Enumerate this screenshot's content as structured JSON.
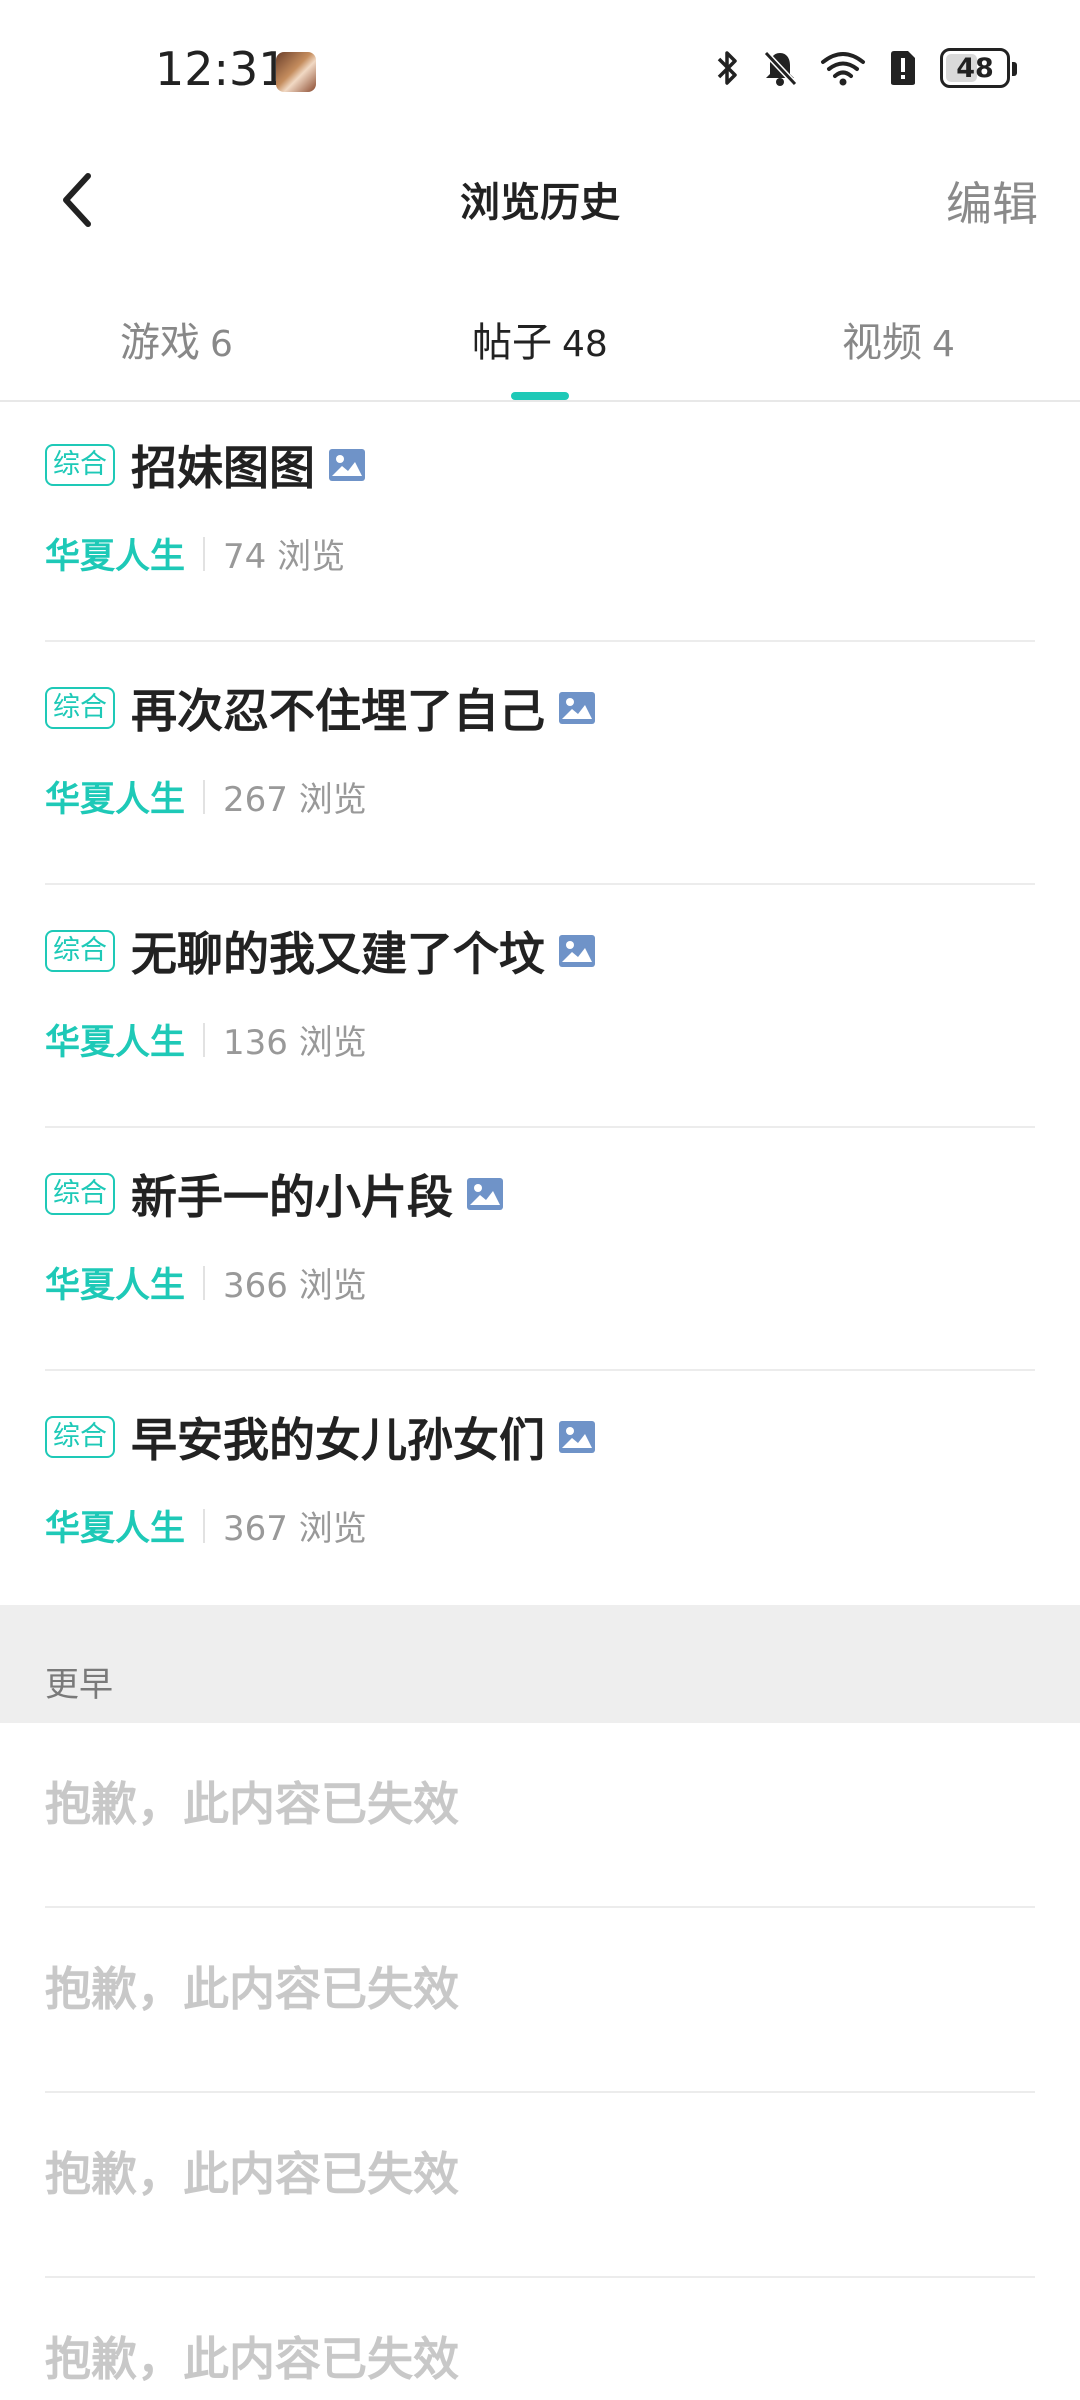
{
  "status_bar": {
    "time": "12:31",
    "battery_level": "48",
    "icons": [
      "bluetooth-icon",
      "bell-off-icon",
      "wifi-icon",
      "sim-alert-icon",
      "battery-icon"
    ]
  },
  "nav": {
    "title": "浏览历史",
    "edit_label": "编辑",
    "back_icon": "chevron-left-icon"
  },
  "tabs": [
    {
      "label": "游戏",
      "count": "6",
      "active": false
    },
    {
      "label": "帖子",
      "count": "48",
      "active": true
    },
    {
      "label": "视频",
      "count": "4",
      "active": false
    }
  ],
  "colors": {
    "accent": "#1ec9b7",
    "image_icon": "#6f93c8",
    "muted_text": "#999999",
    "invalid_text": "#c8c8c8",
    "section_bg": "#eeeeee"
  },
  "posts": [
    {
      "tag": "综合",
      "title": "招妹图图",
      "author": "华夏人生",
      "views": "74 浏览",
      "has_image": true
    },
    {
      "tag": "综合",
      "title": "再次忍不住埋了自己",
      "author": "华夏人生",
      "views": "267 浏览",
      "has_image": true
    },
    {
      "tag": "综合",
      "title": "无聊的我又建了个坟",
      "author": "华夏人生",
      "views": "136 浏览",
      "has_image": true
    },
    {
      "tag": "综合",
      "title": "新手一的小片段",
      "author": "华夏人生",
      "views": "366 浏览",
      "has_image": true
    },
    {
      "tag": "综合",
      "title": "早安我的女儿孙女们",
      "author": "华夏人生",
      "views": "367 浏览",
      "has_image": true
    }
  ],
  "earlier_section": {
    "label": "更早",
    "items": [
      {
        "text": "抱歉，此内容已失效"
      },
      {
        "text": "抱歉，此内容已失效"
      },
      {
        "text": "抱歉，此内容已失效"
      },
      {
        "text": "抱歉，此内容已失效"
      }
    ]
  }
}
